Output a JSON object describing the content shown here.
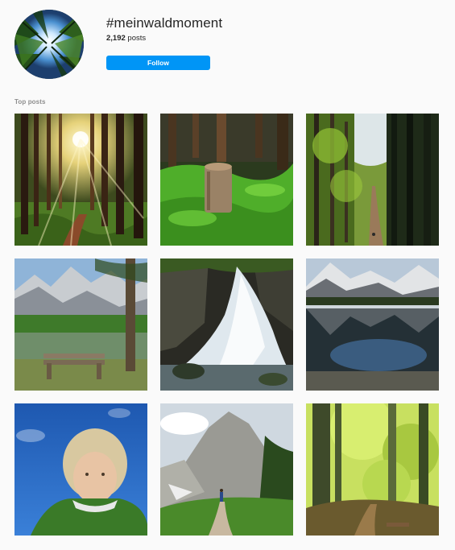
{
  "header": {
    "hashtag": "#meinwaldmoment",
    "posts_count": "2,192",
    "posts_word": "posts",
    "follow_label": "Follow",
    "avatar_icon": "forest-canopy-avatar"
  },
  "section": {
    "label": "Top posts"
  },
  "colors": {
    "accent": "#0095f6",
    "background": "#fafafa",
    "muted_text": "#8e8e8e"
  },
  "posts": [
    {
      "subject": "sunlit-forest"
    },
    {
      "subject": "mossy-stump"
    },
    {
      "subject": "forest-path"
    },
    {
      "subject": "alpine-lake-bench"
    },
    {
      "subject": "waterfall"
    },
    {
      "subject": "mountain-lake-reflection"
    },
    {
      "subject": "selfie-blue-sky"
    },
    {
      "subject": "mountain-trail-hiker"
    },
    {
      "subject": "spring-beech-forest"
    }
  ]
}
